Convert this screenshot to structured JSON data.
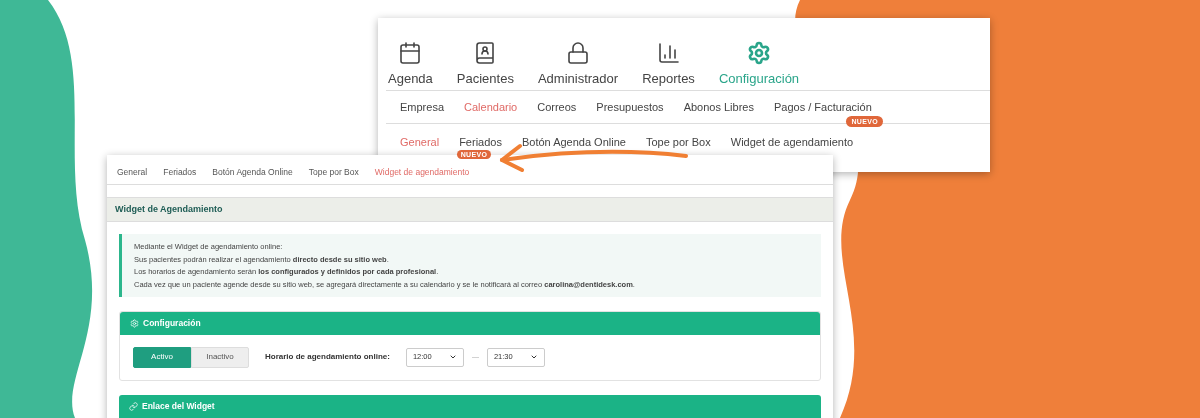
{
  "back_window": {
    "nav": [
      {
        "label": "Agenda",
        "selected": false
      },
      {
        "label": "Pacientes",
        "selected": false
      },
      {
        "label": "Administrador",
        "selected": false
      },
      {
        "label": "Reportes",
        "selected": false
      },
      {
        "label": "Configuración",
        "selected": true
      }
    ],
    "tabs": [
      {
        "label": "Empresa",
        "selected": false
      },
      {
        "label": "Calendario",
        "selected": true
      },
      {
        "label": "Correos",
        "selected": false
      },
      {
        "label": "Presupuestos",
        "selected": false
      },
      {
        "label": "Abonos Libres",
        "selected": false
      },
      {
        "label": "Pagos / Facturación",
        "selected": false
      }
    ],
    "subtabs": [
      {
        "label": "General",
        "selected": true
      },
      {
        "label": "Feriados",
        "selected": false
      },
      {
        "label": "Botón Agenda Online",
        "selected": false
      },
      {
        "label": "Tope por Box",
        "selected": false
      },
      {
        "label": "Widget de agendamiento",
        "selected": false,
        "badge": "NUEVO"
      }
    ]
  },
  "front_window": {
    "tabs": [
      {
        "label": "General",
        "selected": false
      },
      {
        "label": "Feriados",
        "selected": false
      },
      {
        "label": "Botón Agenda Online",
        "selected": false
      },
      {
        "label": "Tope por Box",
        "selected": false
      },
      {
        "label": "Widget de agendamiento",
        "selected": true,
        "badge": "NUEVO"
      }
    ],
    "section_title": "Widget de Agendamiento",
    "info": [
      "Mediante el Widget de agendamiento online:",
      "Sus pacientes podrán realizar el agendamiento **directo desde su sitio web**.",
      "Los horarios de agendamiento serán **los configurados y definidos por cada profesional**.",
      "Cada vez que un paciente agende desde su sitio web, se agregará directamente a su calendario y se le notificará al correo **carolina@dentidesk.com**."
    ],
    "config_panel": {
      "title": "Configuración",
      "status": [
        {
          "label": "Activo",
          "selected": true
        },
        {
          "label": "Inactivo",
          "selected": false
        }
      ],
      "schedule_label": "Horario de agendamiento online:",
      "from": "12:00",
      "separator": "—",
      "to": "21:30"
    },
    "link_panel": {
      "title": "Enlace del Widget"
    }
  }
}
